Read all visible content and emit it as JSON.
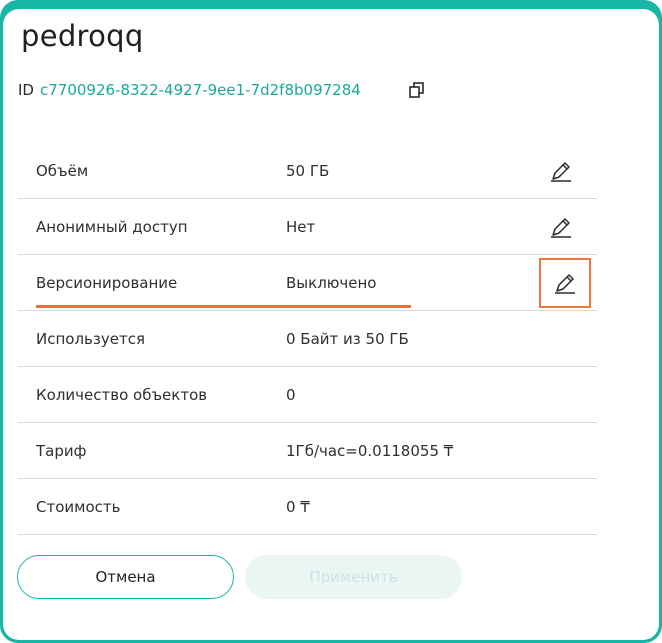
{
  "header": {
    "title": "pedroqq"
  },
  "id": {
    "label": "ID",
    "value": "c7700926-8322-4927-9ee1-7d2f8b097284"
  },
  "rows": [
    {
      "label": "Объём",
      "value": "50 ГБ"
    },
    {
      "label": "Анонимный доступ",
      "value": "Нет"
    },
    {
      "label": "Версионирование",
      "value": "Выключено"
    },
    {
      "label": "Используется",
      "value": "0 Байт из 50 ГБ"
    },
    {
      "label": "Количество объектов",
      "value": "0"
    },
    {
      "label": "Тариф",
      "value": "1Гб/час=0.0118055 ₸"
    },
    {
      "label": "Стоимость",
      "value": "0 ₸"
    }
  ],
  "buttons": {
    "cancel": "Отмена",
    "apply": "Применить"
  },
  "icons": {
    "copy": "copy-icon",
    "edit": "pencil-icon"
  },
  "colors": {
    "accent": "#18b6a6",
    "highlight": "#ed7840",
    "underline": "#ee6d39"
  }
}
